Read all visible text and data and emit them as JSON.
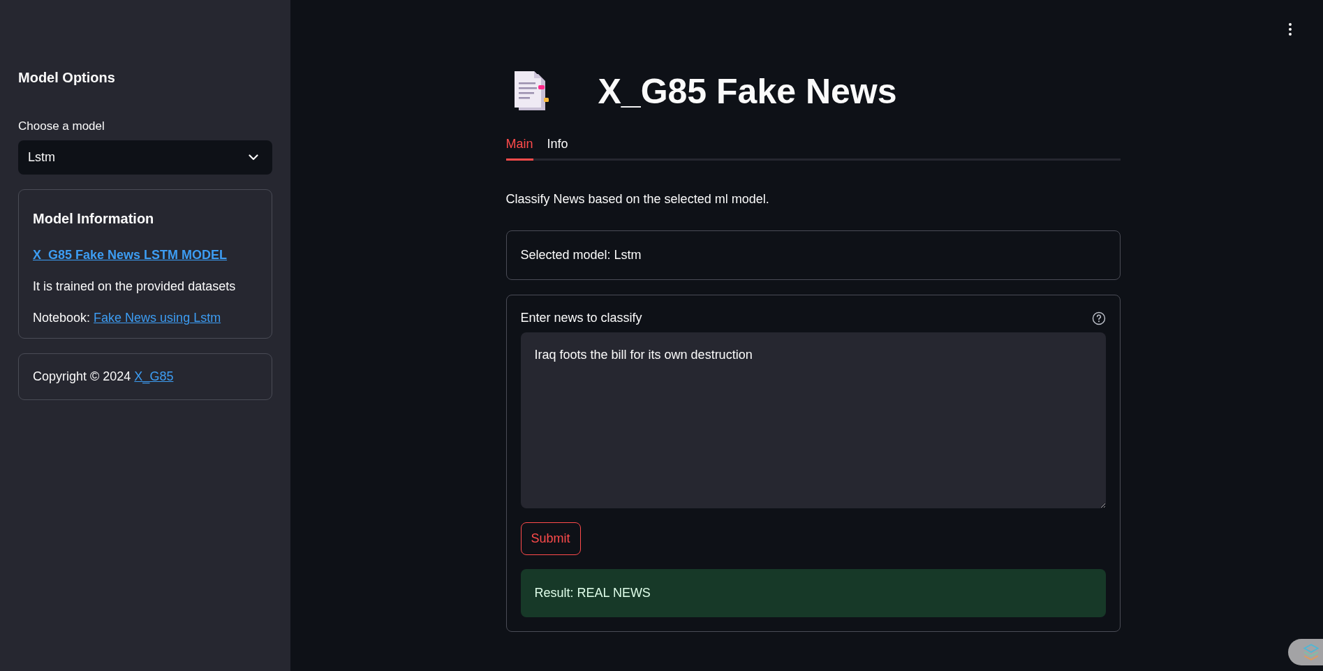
{
  "sidebar": {
    "title": "Model Options",
    "select": {
      "label": "Choose a model",
      "value": "Lstm"
    },
    "info_card": {
      "title": "Model Information",
      "link": "X_G85 Fake News LSTM MODEL",
      "description": "It is trained on the provided datasets",
      "notebook_label": "Notebook:",
      "notebook_link": "Fake News using Lstm"
    },
    "footer": {
      "text": "Copyright © 2024",
      "link": "X_G85"
    }
  },
  "main": {
    "title": "X_G85 Fake News",
    "tabs": [
      {
        "label": "Main",
        "selected": true
      },
      {
        "label": "Info",
        "selected": false
      }
    ],
    "caption": "Classify News based on the selected ml model.",
    "selected_model": "Selected model: Lstm",
    "input": {
      "label": "Enter news to classify",
      "value": "Iraq foots the bill for its own destruction"
    },
    "submit": "Submit",
    "result": {
      "kind": "success",
      "text": "Result: REAL NEWS"
    }
  }
}
